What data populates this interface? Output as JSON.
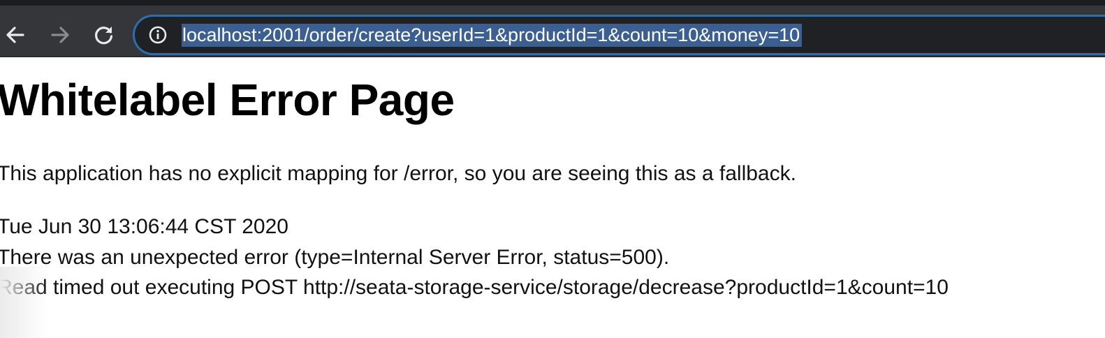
{
  "browser": {
    "back_icon": "arrow-left-icon",
    "forward_icon": "arrow-right-icon",
    "reload_icon": "reload-icon",
    "site_info_icon": "info-circle-icon",
    "url": "localhost:2001/order/create?userId=1&productId=1&count=10&money=10",
    "colors": {
      "toolbar": "#35363a",
      "omnibox_border": "#2c6fb0",
      "url_selection": "#3b5f90"
    }
  },
  "page": {
    "title": "Whitelabel Error Page",
    "description": "This application has no explicit mapping for /error, so you are seeing this as a fallback.",
    "timestamp": "Tue Jun 30 13:06:44 CST 2020",
    "error_line": "There was an unexpected error (type=Internal Server Error, status=500).",
    "message": "Read timed out executing POST http://seata-storage-service/storage/decrease?productId=1&count=10"
  }
}
